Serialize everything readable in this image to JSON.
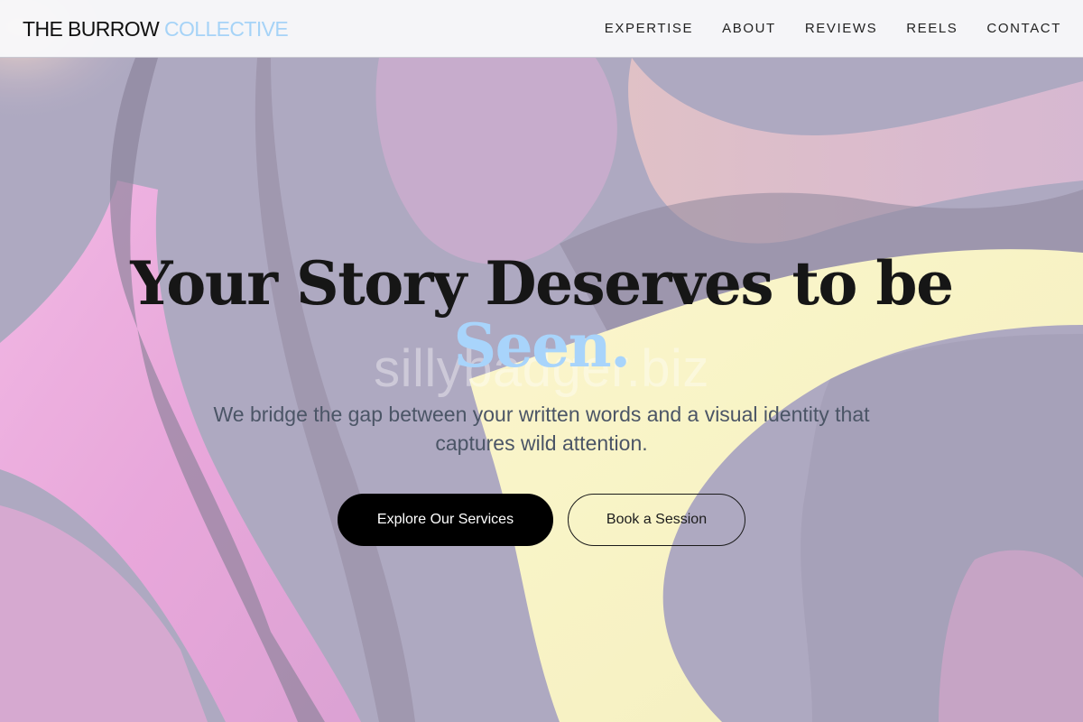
{
  "brand": {
    "name_main": "THE BURROW",
    "name_accent": "COLLECTIVE",
    "accent_color": "#a6d3f7"
  },
  "nav": {
    "items": [
      {
        "label": "EXPERTISE"
      },
      {
        "label": "ABOUT"
      },
      {
        "label": "REVIEWS"
      },
      {
        "label": "REELS"
      },
      {
        "label": "CONTACT"
      }
    ]
  },
  "hero": {
    "headline": "Your Story Deserves to be",
    "headline_accent": "Seen.",
    "headline_accent_color": "#a8d4fb",
    "watermark": "sillybadger.biz",
    "subtext": "We bridge the gap between your written words and a visual identity that captures wild attention.",
    "primary_button": "Explore Our Services",
    "secondary_button": "Book a Session",
    "background": {
      "description_colors": [
        "#a9a3bd",
        "#e8a6dc",
        "#f6f3c2",
        "#8d859d"
      ]
    }
  }
}
